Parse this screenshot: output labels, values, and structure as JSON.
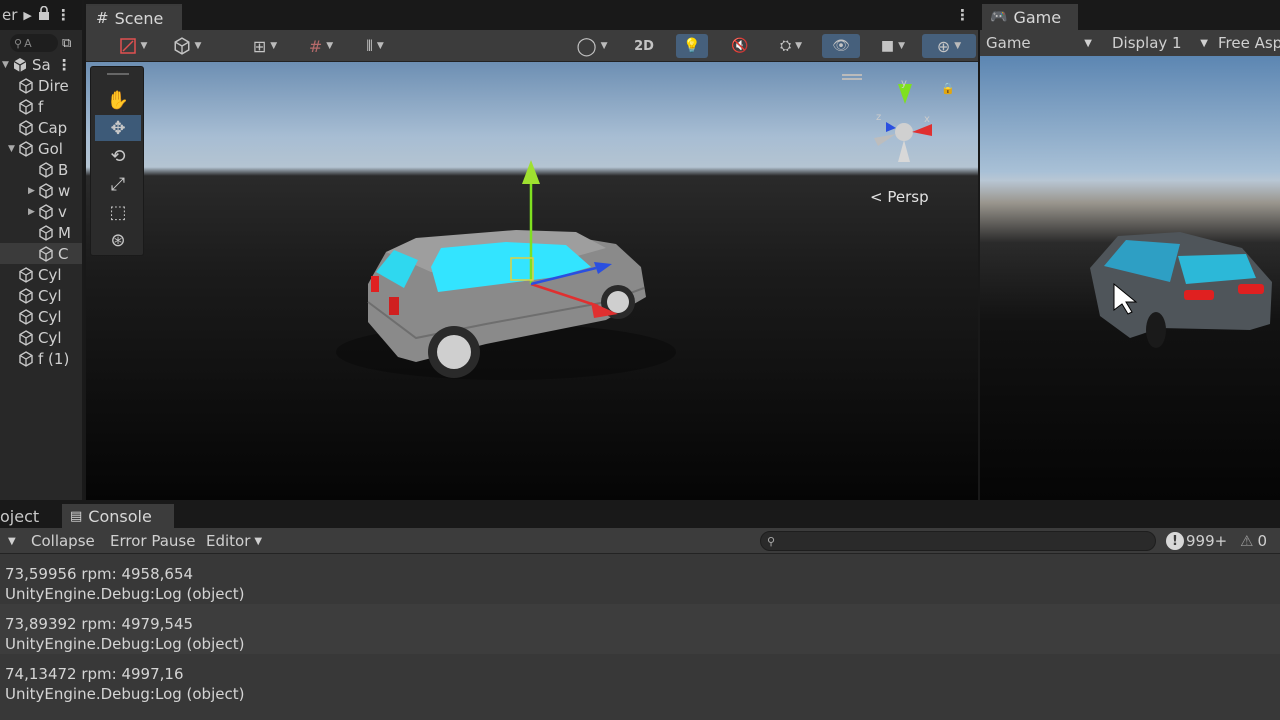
{
  "hierarchy": {
    "tab_label": "er",
    "scene_label": "Sa",
    "search_placeholder": "A",
    "items": [
      {
        "label": "Dire",
        "indent": 0
      },
      {
        "label": "f",
        "indent": 0
      },
      {
        "label": "Cap",
        "indent": 0
      },
      {
        "label": "Gol",
        "indent": 0,
        "expanded": true
      },
      {
        "label": "B",
        "indent": 1
      },
      {
        "label": "w",
        "indent": 1,
        "collapsed": true
      },
      {
        "label": "v",
        "indent": 1,
        "collapsed": true
      },
      {
        "label": "M",
        "indent": 1
      },
      {
        "label": "C",
        "indent": 1,
        "selected": true
      },
      {
        "label": "Cyl",
        "indent": 0
      },
      {
        "label": "Cyl",
        "indent": 0
      },
      {
        "label": "Cyl",
        "indent": 0
      },
      {
        "label": "Cyl",
        "indent": 0
      },
      {
        "label": "f (1)",
        "indent": 0
      }
    ]
  },
  "scene": {
    "tab_label": "Scene",
    "toolbar_2d": "2D",
    "persp_label": "Persp",
    "gizmo_y": "y",
    "gizmo_x": "x",
    "gizmo_z": "z"
  },
  "game": {
    "tab_label": "Game",
    "mode": "Game",
    "display": "Display 1",
    "aspect": "Free Asp"
  },
  "console": {
    "object_tab": "oject",
    "tab_label": "Console",
    "collapse": "Collapse",
    "error_pause": "Error Pause",
    "editor": "Editor",
    "error_count": "999+",
    "warning_count": "0",
    "entries": [
      {
        "line1": "73,59956 rpm: 4958,654",
        "line2": "UnityEngine.Debug:Log (object)"
      },
      {
        "line1": "73,89392 rpm: 4979,545",
        "line2": "UnityEngine.Debug:Log (object)"
      },
      {
        "line1": "74,13472 rpm: 4997,16",
        "line2": "UnityEngine.Debug:Log (object)"
      }
    ]
  },
  "colors": {
    "selection_blue": "#46607c",
    "car_body": "#8a8a8a",
    "car_glass": "#2ee0ff",
    "tail_light": "#e02020"
  }
}
